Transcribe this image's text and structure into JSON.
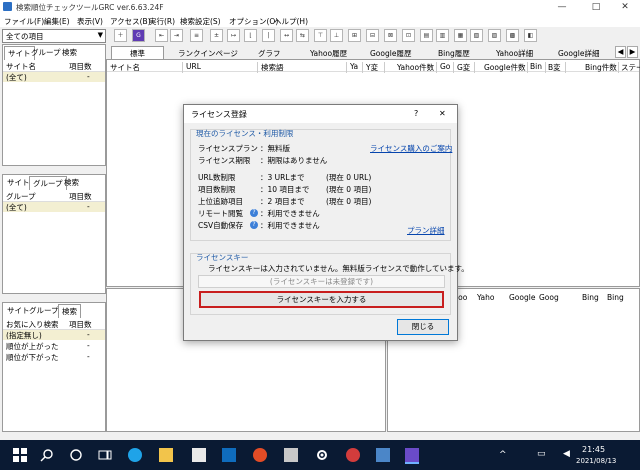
{
  "window": {
    "title": "検索順位チェックツールGRC ver.6.63.24F"
  },
  "menu": [
    "ファイル(F)",
    "編集(E)",
    "表示(V)",
    "アクセス(B)",
    "実行(R)",
    "検索設定(S)",
    "オプション(O)",
    "ヘルプ(H)"
  ],
  "toolbar": {
    "group_select": "全ての項目"
  },
  "panel1": {
    "tabs": [
      "サイト",
      "グループ",
      "検索"
    ],
    "col_name": "サイト名",
    "col_count": "項目数",
    "row": "(全て)",
    "row_count": "-"
  },
  "panel2": {
    "tabs": [
      "サイト",
      "グループ",
      "検索"
    ],
    "col_name": "グループ",
    "col_count": "項目数",
    "row": "(全て)",
    "row_count": "-"
  },
  "panel3": {
    "tabs": [
      "サイト",
      "グループ",
      "検索"
    ],
    "col_name": "お気に入り検索",
    "col_count": "項目数",
    "rows": [
      {
        "name": "(指定無し)",
        "count": "-"
      },
      {
        "name": "順位が上がった",
        "count": "-"
      },
      {
        "name": "順位が下がった",
        "count": "-"
      }
    ]
  },
  "main": {
    "tabs": [
      "標準",
      "ランクインページ",
      "グラフ",
      "Yahoo履歴",
      "Google履歴",
      "Bing履歴",
      "Yahoo詳細",
      "Google詳細"
    ],
    "columns": [
      "サイト名",
      "URL",
      "検索語",
      "Ya",
      "Y変",
      "Yahoo件数",
      "Go",
      "G変",
      "Google件数",
      "Bin",
      "B変",
      "Bing件数",
      "ステー"
    ]
  },
  "lower_grid": {
    "columns": [
      "Boo",
      "Yaho",
      "Google",
      "Goog",
      "Bing",
      "Bing"
    ]
  },
  "dialog": {
    "title": "ライセンス登録",
    "help_btn": "?",
    "close_x": "✕",
    "section1": "現在のライセンス・利用制限",
    "buy_link": "ライセンス購入のご案内",
    "plan_label": "ライセンスプラン",
    "plan_value": "：無料版",
    "period_label": "ライセンス期限",
    "period_value": "：期限はありません",
    "url_label": "URL数制限",
    "url_value": "：3 URLまで",
    "url_now": "(現在 0 URL)",
    "item_label": "項目数制限",
    "item_value": "：10 項目まで",
    "item_now": "(現在 0 項目)",
    "top_label": "上位追跡項目",
    "top_value": "：2 項目まで",
    "top_now": "(現在 0 項目)",
    "remote_label": "リモート閲覧",
    "remote_value": "：利用できません",
    "csv_label": "CSV自動保存",
    "csv_value": "：利用できません",
    "plan_detail_link": "プラン詳細",
    "section2": "ライセンスキー",
    "key_message": "ライセンスキーは入力されていません。無料版ライセンスで動作しています。",
    "key_status": "(ライセンスキーは未登録です)",
    "enter_key_btn": "ライセンスキーを入力する",
    "close_btn": "閉じる"
  },
  "taskbar": {
    "time": "21:45",
    "date": "2021/08/13"
  }
}
